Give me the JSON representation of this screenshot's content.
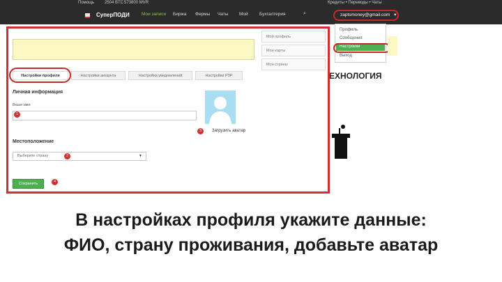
{
  "topbar": {
    "help": "Помощь",
    "btc": "2504 BTC",
    "mvr": "573800 MVR",
    "logo": "СуперПОДИ",
    "nav": [
      "Мои записи",
      "Биржа",
      "Фермы",
      "Чаты",
      "Мой",
      "Бухгалтерия"
    ],
    "right_links": "Кредиты • Переводы • Чаты",
    "email": "zaptsmoney@gmail.com"
  },
  "account_dropdown": {
    "items": [
      "Профиль",
      "Сообщения",
      "Настройки",
      "Выход"
    ],
    "active": "Настройки"
  },
  "right_panel": {
    "tech_heading": "ЕХНОЛОГИЯ"
  },
  "profile": {
    "sidebar_menu": [
      "Мой профиль",
      "Мои карты",
      "Мои страны"
    ],
    "tabs": [
      "Настройки профиля",
      "Настройки аккаунта",
      "Настройки уведомлений",
      "Настройки РЗР"
    ],
    "basic_info_title": "Личная информация",
    "name_label": "Ваше имя",
    "upload_avatar": "Загрузить аватар",
    "location_title": "Местоположение",
    "country_placeholder": "Выберите страну",
    "save_label": "Сохранить",
    "markers": [
      "1",
      "2",
      "3",
      "4"
    ]
  },
  "caption": {
    "line1": "В настройках профиля укажите данные:",
    "line2": "ФИО, страну проживания, добавьте аватар"
  },
  "colors": {
    "highlight_red": "#d32f2f",
    "accent_green": "#4caf50",
    "topbar_bg": "#2b2b2b",
    "banner_yellow": "#fbf8c4"
  }
}
